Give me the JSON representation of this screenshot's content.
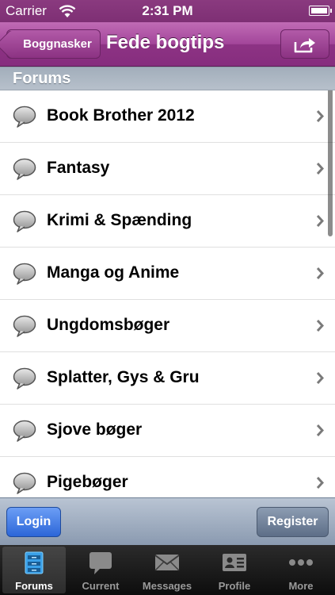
{
  "status_bar": {
    "carrier": "Carrier",
    "time": "2:31 PM"
  },
  "nav": {
    "back_label": "Boggnasker",
    "title": "Fede bogtips"
  },
  "section": {
    "title": "Forums"
  },
  "forums": [
    {
      "label": "Book Brother 2012"
    },
    {
      "label": "Fantasy"
    },
    {
      "label": "Krimi & Spænding"
    },
    {
      "label": "Manga og Anime"
    },
    {
      "label": "Ungdomsbøger"
    },
    {
      "label": "Splatter, Gys & Gru"
    },
    {
      "label": "Sjove bøger"
    },
    {
      "label": "Pigebøger"
    }
  ],
  "toolbar": {
    "login_label": "Login",
    "register_label": "Register"
  },
  "tabs": [
    {
      "label": "Forums",
      "icon": "forums-icon",
      "selected": true
    },
    {
      "label": "Current",
      "icon": "current-icon",
      "selected": false
    },
    {
      "label": "Messages",
      "icon": "messages-icon",
      "selected": false
    },
    {
      "label": "Profile",
      "icon": "profile-icon",
      "selected": false
    },
    {
      "label": "More",
      "icon": "more-icon",
      "selected": false
    }
  ],
  "colors": {
    "nav_purple": "#a3469a",
    "login_blue": "#2c66d8"
  }
}
